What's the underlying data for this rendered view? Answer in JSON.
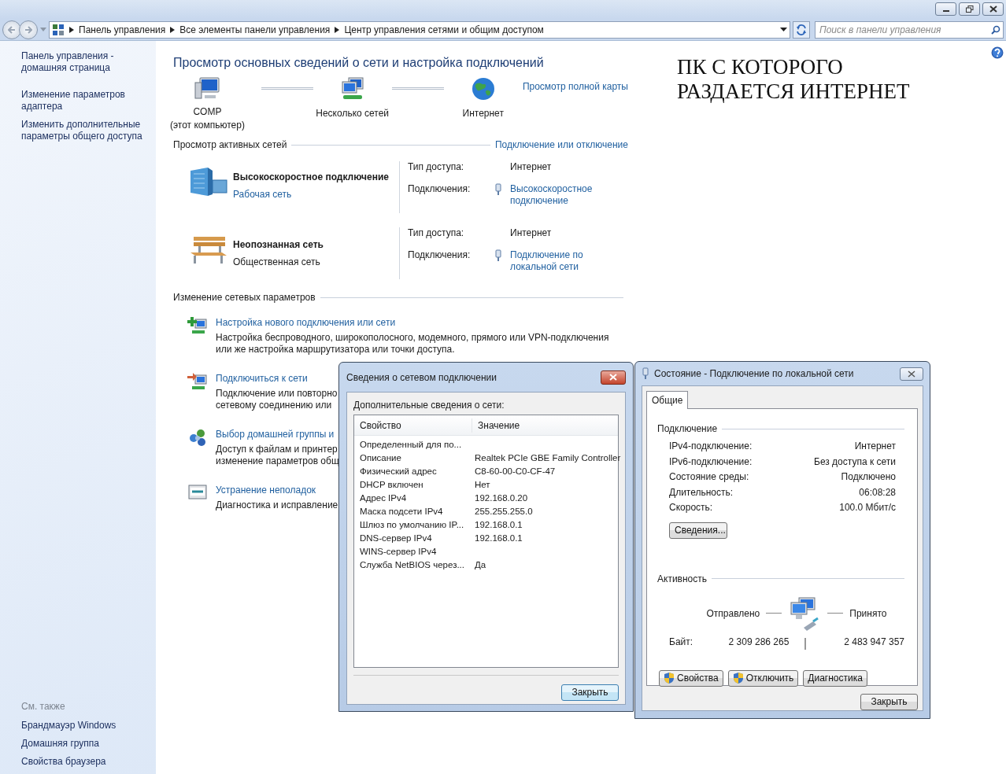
{
  "window": {
    "breadcrumbs": [
      "Панель управления",
      "Все элементы панели управления",
      "Центр управления сетями и общим доступом"
    ],
    "search": {
      "placeholder": "Поиск в панели управления"
    }
  },
  "sidebar": {
    "links": [
      "Панель управления - домашняя страница",
      "Изменение параметров адаптера",
      "Изменить дополнительные параметры общего доступа"
    ],
    "see_also_heading": "См. также",
    "see_also": [
      "Брандмауэр Windows",
      "Домашняя группа",
      "Свойства браузера"
    ]
  },
  "main": {
    "title": "Просмотр основных сведений о сети и настройка подключений",
    "network_map": {
      "nodes": [
        {
          "kind": "computer",
          "label": "COMP",
          "sublabel": "(этот компьютер)"
        },
        {
          "kind": "networks",
          "label": "Несколько сетей"
        },
        {
          "kind": "internet",
          "label": "Интернет"
        }
      ],
      "full_map_link": "Просмотр полной карты"
    },
    "active_networks": {
      "heading": "Просмотр активных сетей",
      "link": "Подключение или отключение",
      "networks": [
        {
          "kind": "domain",
          "name": "Высокоскоростное подключение",
          "category": "Рабочая сеть",
          "category_is_link": true,
          "access_label": "Тип доступа:",
          "access_value": "Интернет",
          "connections_label": "Подключения:",
          "connection_link": "Высокоскоростное подключение"
        },
        {
          "kind": "public",
          "name": "Неопознанная сеть",
          "category": "Общественная сеть",
          "category_is_link": false,
          "access_label": "Тип доступа:",
          "access_value": "Интернет",
          "connections_label": "Подключения:",
          "connection_link": "Подключение по локальной сети"
        }
      ]
    },
    "change_settings": {
      "heading": "Изменение сетевых параметров",
      "tasks": [
        {
          "kind": "new",
          "title": "Настройка нового подключения или сети",
          "description": "Настройка беспроводного, широкополосного, модемного, прямого или VPN-подключения\nили же настройка маршрутизатора или точки доступа."
        },
        {
          "kind": "connect",
          "title": "Подключиться к сети",
          "description": "Подключение или повторно\nсетевому соединению или"
        },
        {
          "kind": "homegroup",
          "title": "Выбор домашней группы и",
          "description": "Доступ к файлам и принтер\nизменение параметров общ"
        },
        {
          "kind": "troubleshoot",
          "title": "Устранение неполадок",
          "description": "Диагностика и исправление"
        }
      ]
    }
  },
  "annotation": "ПК С КОТОРОГО\nРАЗДАЕТСЯ ИНТЕРНЕТ",
  "details_dialog": {
    "title": "Сведения о сетевом подключении",
    "caption": "Дополнительные сведения о сети:",
    "columns": [
      "Свойство",
      "Значение"
    ],
    "rows": [
      {
        "property": "Определенный для по...",
        "value": ""
      },
      {
        "property": "Описание",
        "value": "Realtek PCIe GBE Family Controller"
      },
      {
        "property": "Физический адрес",
        "value": "C8-60-00-C0-CF-47"
      },
      {
        "property": "DHCP включен",
        "value": "Нет"
      },
      {
        "property": "Адрес IPv4",
        "value": "192.168.0.20"
      },
      {
        "property": "Маска подсети IPv4",
        "value": "255.255.255.0"
      },
      {
        "property": "Шлюз по умолчанию IP...",
        "value": "192.168.0.1"
      },
      {
        "property": "DNS-сервер IPv4",
        "value": "192.168.0.1"
      },
      {
        "property": "WINS-сервер IPv4",
        "value": ""
      },
      {
        "property": "Служба NetBIOS через...",
        "value": "Да"
      }
    ],
    "close_button": "Закрыть"
  },
  "status_dialog": {
    "title": "Состояние - Подключение по локальной сети",
    "tabs": [
      {
        "label": "Общие",
        "selected": true
      }
    ],
    "connection_heading": "Подключение",
    "fields": [
      {
        "label": "IPv4-подключение:",
        "value": "Интернет"
      },
      {
        "label": "IPv6-подключение:",
        "value": "Без доступа к сети"
      },
      {
        "label": "Состояние среды:",
        "value": "Подключено"
      },
      {
        "label": "Длительность:",
        "value": "06:08:28"
      },
      {
        "label": "Скорость:",
        "value": "100.0 Мбит/с"
      }
    ],
    "details_button": "Сведения...",
    "activity_heading": "Активность",
    "sent_label": "Отправлено",
    "received_label": "Принято",
    "bytes_label": "Байт:",
    "sent_bytes": "2 309 286 265",
    "received_bytes": "2 483 947 357",
    "buttons": [
      {
        "label": "Свойства",
        "shield": true
      },
      {
        "label": "Отключить",
        "shield": true
      },
      {
        "label": "Диагностика",
        "shield": false
      }
    ],
    "close_button": "Закрыть"
  }
}
